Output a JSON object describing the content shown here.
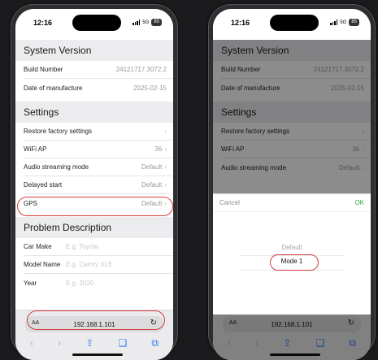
{
  "status": {
    "time": "12:16",
    "network": "5G",
    "battery": "85"
  },
  "sections": {
    "system_version": "System Version",
    "settings": "Settings",
    "problem_description": "Problem Description"
  },
  "system_rows": [
    {
      "label": "Build Number",
      "value": "24121717.3072.2"
    },
    {
      "label": "Date of manufacture",
      "value": "2025-02-15"
    }
  ],
  "settings_rows": [
    {
      "label": "Restore factory settings",
      "value": ""
    },
    {
      "label": "WiFi AP",
      "value": "36"
    },
    {
      "label": "Audio streaming mode",
      "value": "Default"
    },
    {
      "label": "Delayed start",
      "value": "Default"
    },
    {
      "label": "GPS",
      "value": "Default"
    }
  ],
  "problem_fields": [
    {
      "label": "Car Make",
      "placeholder": "E.g. Toyota"
    },
    {
      "label": "Model Name",
      "placeholder": "E.g. Camry XLE"
    },
    {
      "label": "Year",
      "placeholder": "E.g. 2020"
    }
  ],
  "browser": {
    "text_size": "AA",
    "url": "192.168.1.101"
  },
  "icons": {
    "chevron": "chevron-right-icon",
    "reload": "reload-icon",
    "back": "back-icon",
    "forward": "forward-icon",
    "share": "share-icon",
    "bookmarks": "bookmarks-icon",
    "tabs": "tabs-icon"
  },
  "picker": {
    "cancel": "Cancel",
    "ok": "OK",
    "options": [
      "Default",
      "Mode 1"
    ],
    "selected": "Mode 1"
  },
  "colors": {
    "highlight": "#d63c3c",
    "ok": "#35a548",
    "link": "#2f7cf6"
  }
}
